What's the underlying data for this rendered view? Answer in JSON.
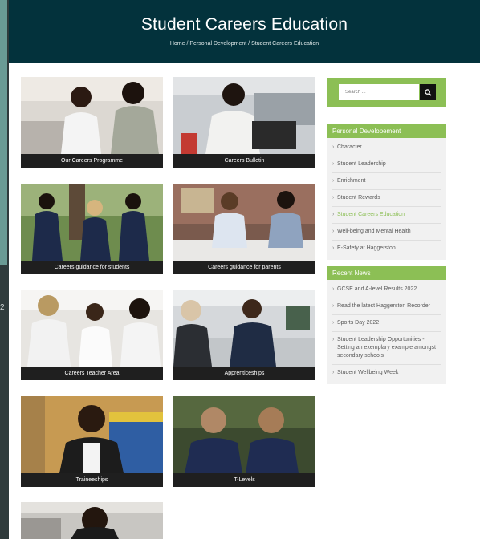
{
  "header": {
    "title": "Student Careers Education",
    "breadcrumb": [
      "Home",
      "Personal Development",
      "Student Careers Education"
    ],
    "separator": "/"
  },
  "left_strip_text": "2",
  "tiles": [
    {
      "label": "Our Careers Programme"
    },
    {
      "label": "Careers Bulletin"
    },
    {
      "label": "Careers guidance for students"
    },
    {
      "label": "Careers guidance for parents"
    },
    {
      "label": "Careers Teacher Area"
    },
    {
      "label": "Apprenticeships"
    },
    {
      "label": "Traineeships"
    },
    {
      "label": "T-Levels"
    }
  ],
  "search": {
    "placeholder": "Search ..."
  },
  "personal_development": {
    "title": "Personal Developement",
    "items": [
      "Character",
      "Student Leadership",
      "Enrichment",
      "Student Rewards",
      "Student Careers Education",
      "Well-being and Mental Health",
      "E-Safety at Haggerston"
    ],
    "active": "Student Careers Education"
  },
  "recent_news": {
    "title": "Recent News",
    "items": [
      "GCSE and A-level Results 2022",
      "Read the latest Haggerston Recorder",
      "Sports Day 2022",
      "Student Leadership Opportunities - Setting an exemplary example amongst secondary schools",
      "Student Wellbeing Week"
    ]
  },
  "colors": {
    "header_bg": "#03323c",
    "accent_green": "#8cbf55",
    "caption_bg": "#1f1f1f"
  }
}
